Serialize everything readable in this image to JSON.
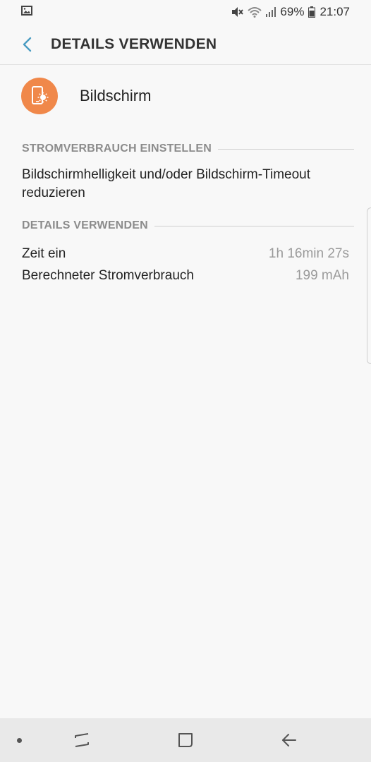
{
  "status_bar": {
    "battery": "69%",
    "time": "21:07",
    "icons": [
      "image-icon",
      "mute-icon",
      "wifi-icon",
      "signal-icon",
      "battery-icon"
    ]
  },
  "app_bar": {
    "title": "DETAILS VERWENDEN",
    "back_icon": "chevron-left-icon"
  },
  "app": {
    "name": "Bildschirm",
    "icon": "screen-brightness-icon",
    "icon_color": "#f0884a"
  },
  "sections": {
    "power": {
      "header": "STROMVERBRAUCH EINSTELLEN",
      "hint": "Bildschirmhelligkeit und/oder Bildschirm-Timeout reduzieren"
    },
    "details": {
      "header": "DETAILS VERWENDEN",
      "rows": [
        {
          "label": "Zeit ein",
          "value": "1h 16min 27s"
        },
        {
          "label": "Berechneter Stromverbrauch",
          "value": "199 mAh"
        }
      ]
    }
  },
  "nav_bar": {
    "icons": [
      "dot-icon",
      "recents-icon",
      "home-icon",
      "back-arrow-icon"
    ]
  },
  "colors": {
    "accent": "#4a9cc2",
    "background": "#f8f8f8",
    "nav_background": "#e9e9e9"
  }
}
